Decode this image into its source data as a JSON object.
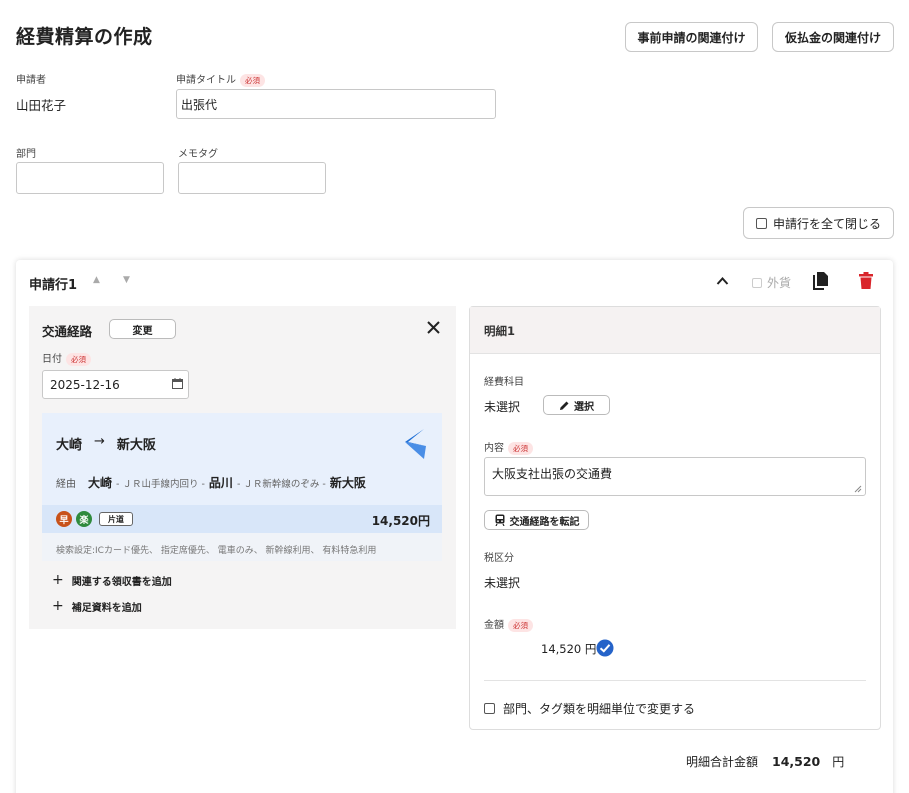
{
  "header": {
    "title": "経費精算の作成",
    "btn_pre_application": "事前申請の関連付け",
    "btn_advance_payment": "仮払金の関連付け"
  },
  "form": {
    "applicant_label": "申請者",
    "applicant_value": "山田花子",
    "title_label": "申請タイトル",
    "required": "必須",
    "title_value": "出張代",
    "dept_label": "部門",
    "memo_label": "メモタグ",
    "collapse_all_label": "申請行を全て閉じる"
  },
  "line": {
    "title": "申請行1",
    "foreign_currency_label": "外貨",
    "route": {
      "title": "交通経路",
      "change_btn": "変更",
      "date_label": "日付",
      "date_value": "2025-12-16",
      "from": "大崎",
      "arrow": "→",
      "to": "新大阪",
      "via_label": "経由",
      "via_start": "大崎",
      "via_line1": "- ＪＲ山手線内回り -",
      "via_mid": "品川",
      "via_line2": "- ＪＲ新幹線のぞみ -",
      "via_end": "新大阪",
      "badge_fast": "早",
      "badge_easy": "楽",
      "oneway": "片道",
      "fare": "14,520円",
      "search_settings": "検索設定:ICカード優先、 指定席優先、 電車のみ、 新幹線利用、 有料特急利用",
      "add_receipt": "関連する領収書を追加",
      "add_material": "補足資料を追加"
    },
    "detail": {
      "title": "明細1",
      "expense_item_label": "経費科目",
      "expense_item_value": "未選択",
      "select_btn": "選択",
      "content_label": "内容",
      "content_value": "大阪支社出張の交通費",
      "transcribe_btn": "交通経路を転記",
      "tax_label": "税区分",
      "tax_value": "未選択",
      "amount_label": "金額",
      "amount_value": "14,520 円",
      "change_per_detail": "部門、タグ類を明細単位で変更する"
    },
    "total_label": "明細合計金額",
    "total_value": "14,520",
    "total_unit": "円"
  },
  "colors": {
    "accent_red": "#d9252b",
    "badge_orange": "#c8521a",
    "badge_green": "#2f8a3d",
    "route_bg": "#e8f0fc",
    "fare_bg": "#d8e6f9",
    "check_blue": "#2563c9",
    "plane_blue": "#1f6fd6"
  },
  "icons": {
    "calendar": "calendar-icon",
    "close": "close-icon",
    "plane": "airline-icon",
    "pencil": "pencil-icon",
    "train": "train-icon",
    "copy": "copy-icon",
    "trash": "trash-icon",
    "check": "check-circle-icon"
  }
}
